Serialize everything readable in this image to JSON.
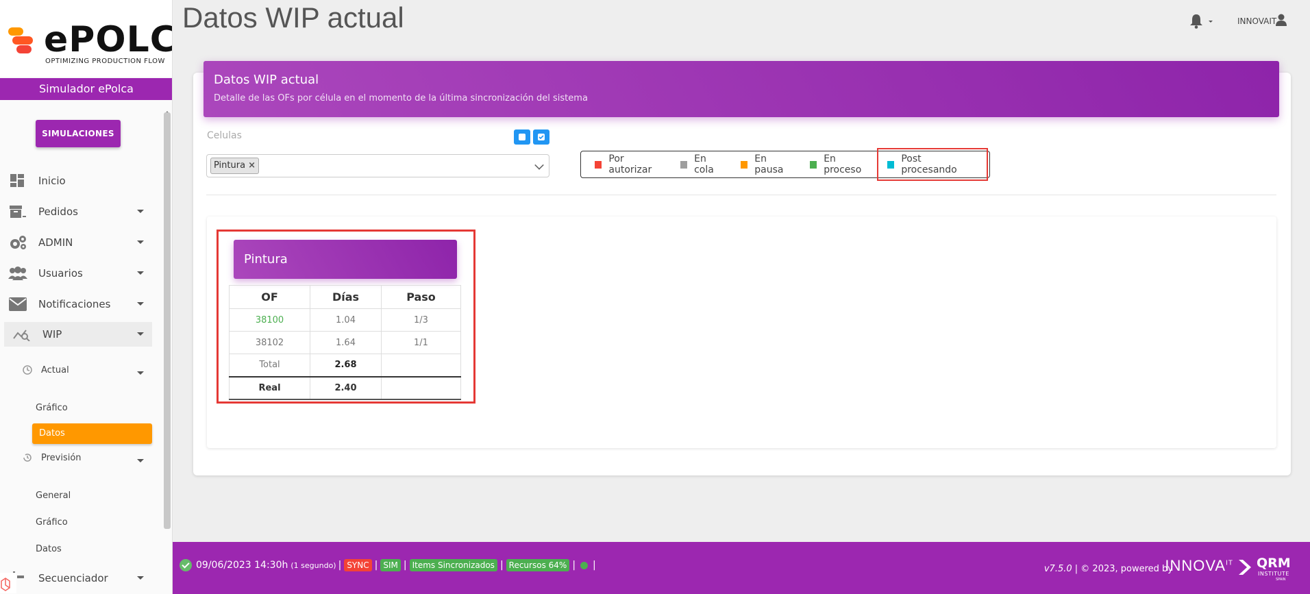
{
  "page": {
    "title": "Datos WIP actual"
  },
  "brand": {
    "name": "ePOLCA",
    "tagline": "OPTIMIZING PRODUCTION FLOW",
    "colors": {
      "purple": "#9c27b0",
      "orange": "#ff9800",
      "blue": "#2196f3"
    }
  },
  "sidebar": {
    "simulator_label": "Simulador ePolca",
    "simulations_button": "SIMULACIONES",
    "items": [
      {
        "label": "Inicio",
        "icon": "dashboard-icon"
      },
      {
        "label": "Pedidos",
        "icon": "archive-box-icon"
      },
      {
        "label": "ADMIN",
        "icon": "gears-icon"
      },
      {
        "label": "Usuarios",
        "icon": "users-icon"
      },
      {
        "label": "Notificaciones",
        "icon": "envelope-icon"
      },
      {
        "label": "WIP",
        "icon": "chart-search-icon"
      }
    ],
    "actual": {
      "label": "Actual",
      "icon": "clock-icon",
      "children": [
        "Gráfico",
        "Datos"
      ]
    },
    "prevision": {
      "label": "Previsión",
      "icon": "history-icon",
      "children": [
        "General",
        "Gráfico",
        "Datos"
      ]
    },
    "secuenciador": {
      "label": "Secuenciador",
      "icon": "sequencer-icon"
    }
  },
  "header": {
    "user": "INNOVAIT"
  },
  "card": {
    "title": "Datos WIP actual",
    "subtitle": "Detalle de las OFs por célula en el momento de la última sincronización del sistema"
  },
  "filters": {
    "label": "Celulas",
    "selected": "Pintura",
    "remove": "×"
  },
  "legend": [
    {
      "label": "Por autorizar",
      "color": "#f44336"
    },
    {
      "label": "En cola",
      "color": "#9e9e9e"
    },
    {
      "label": "En pausa",
      "color": "#ff9800"
    },
    {
      "label": "En proceso",
      "color": "#4caf50"
    },
    {
      "label": "Post procesando",
      "color": "#00bcd4"
    }
  ],
  "cell": {
    "name": "Pintura",
    "headers": [
      "OF",
      "Días",
      "Paso"
    ],
    "rows": [
      {
        "of": "38100",
        "dias": "1.04",
        "paso": "1/3",
        "status_color": "#4caf50"
      },
      {
        "of": "38102",
        "dias": "1.64",
        "paso": "1/1",
        "status_color": "#9e9e9e"
      }
    ],
    "total": {
      "label": "Total",
      "value": "2.68"
    },
    "real": {
      "label": "Real",
      "value": "2.40"
    }
  },
  "footer": {
    "datetime": "09/06/2023 14:30h",
    "interval": "(1 segundo)",
    "sep": "|",
    "badges": [
      "SYNC",
      "SIM",
      "Items Sincronizados",
      "Recursos 64%"
    ],
    "version": "v7.5.0",
    "copyright": "| © 2023, powered by",
    "innova": "INNOVA",
    "innova_sup": "IT",
    "qrm": "QRM",
    "qrm_sub": "INSTITUTE",
    "qrm_country": "SPAIN"
  }
}
